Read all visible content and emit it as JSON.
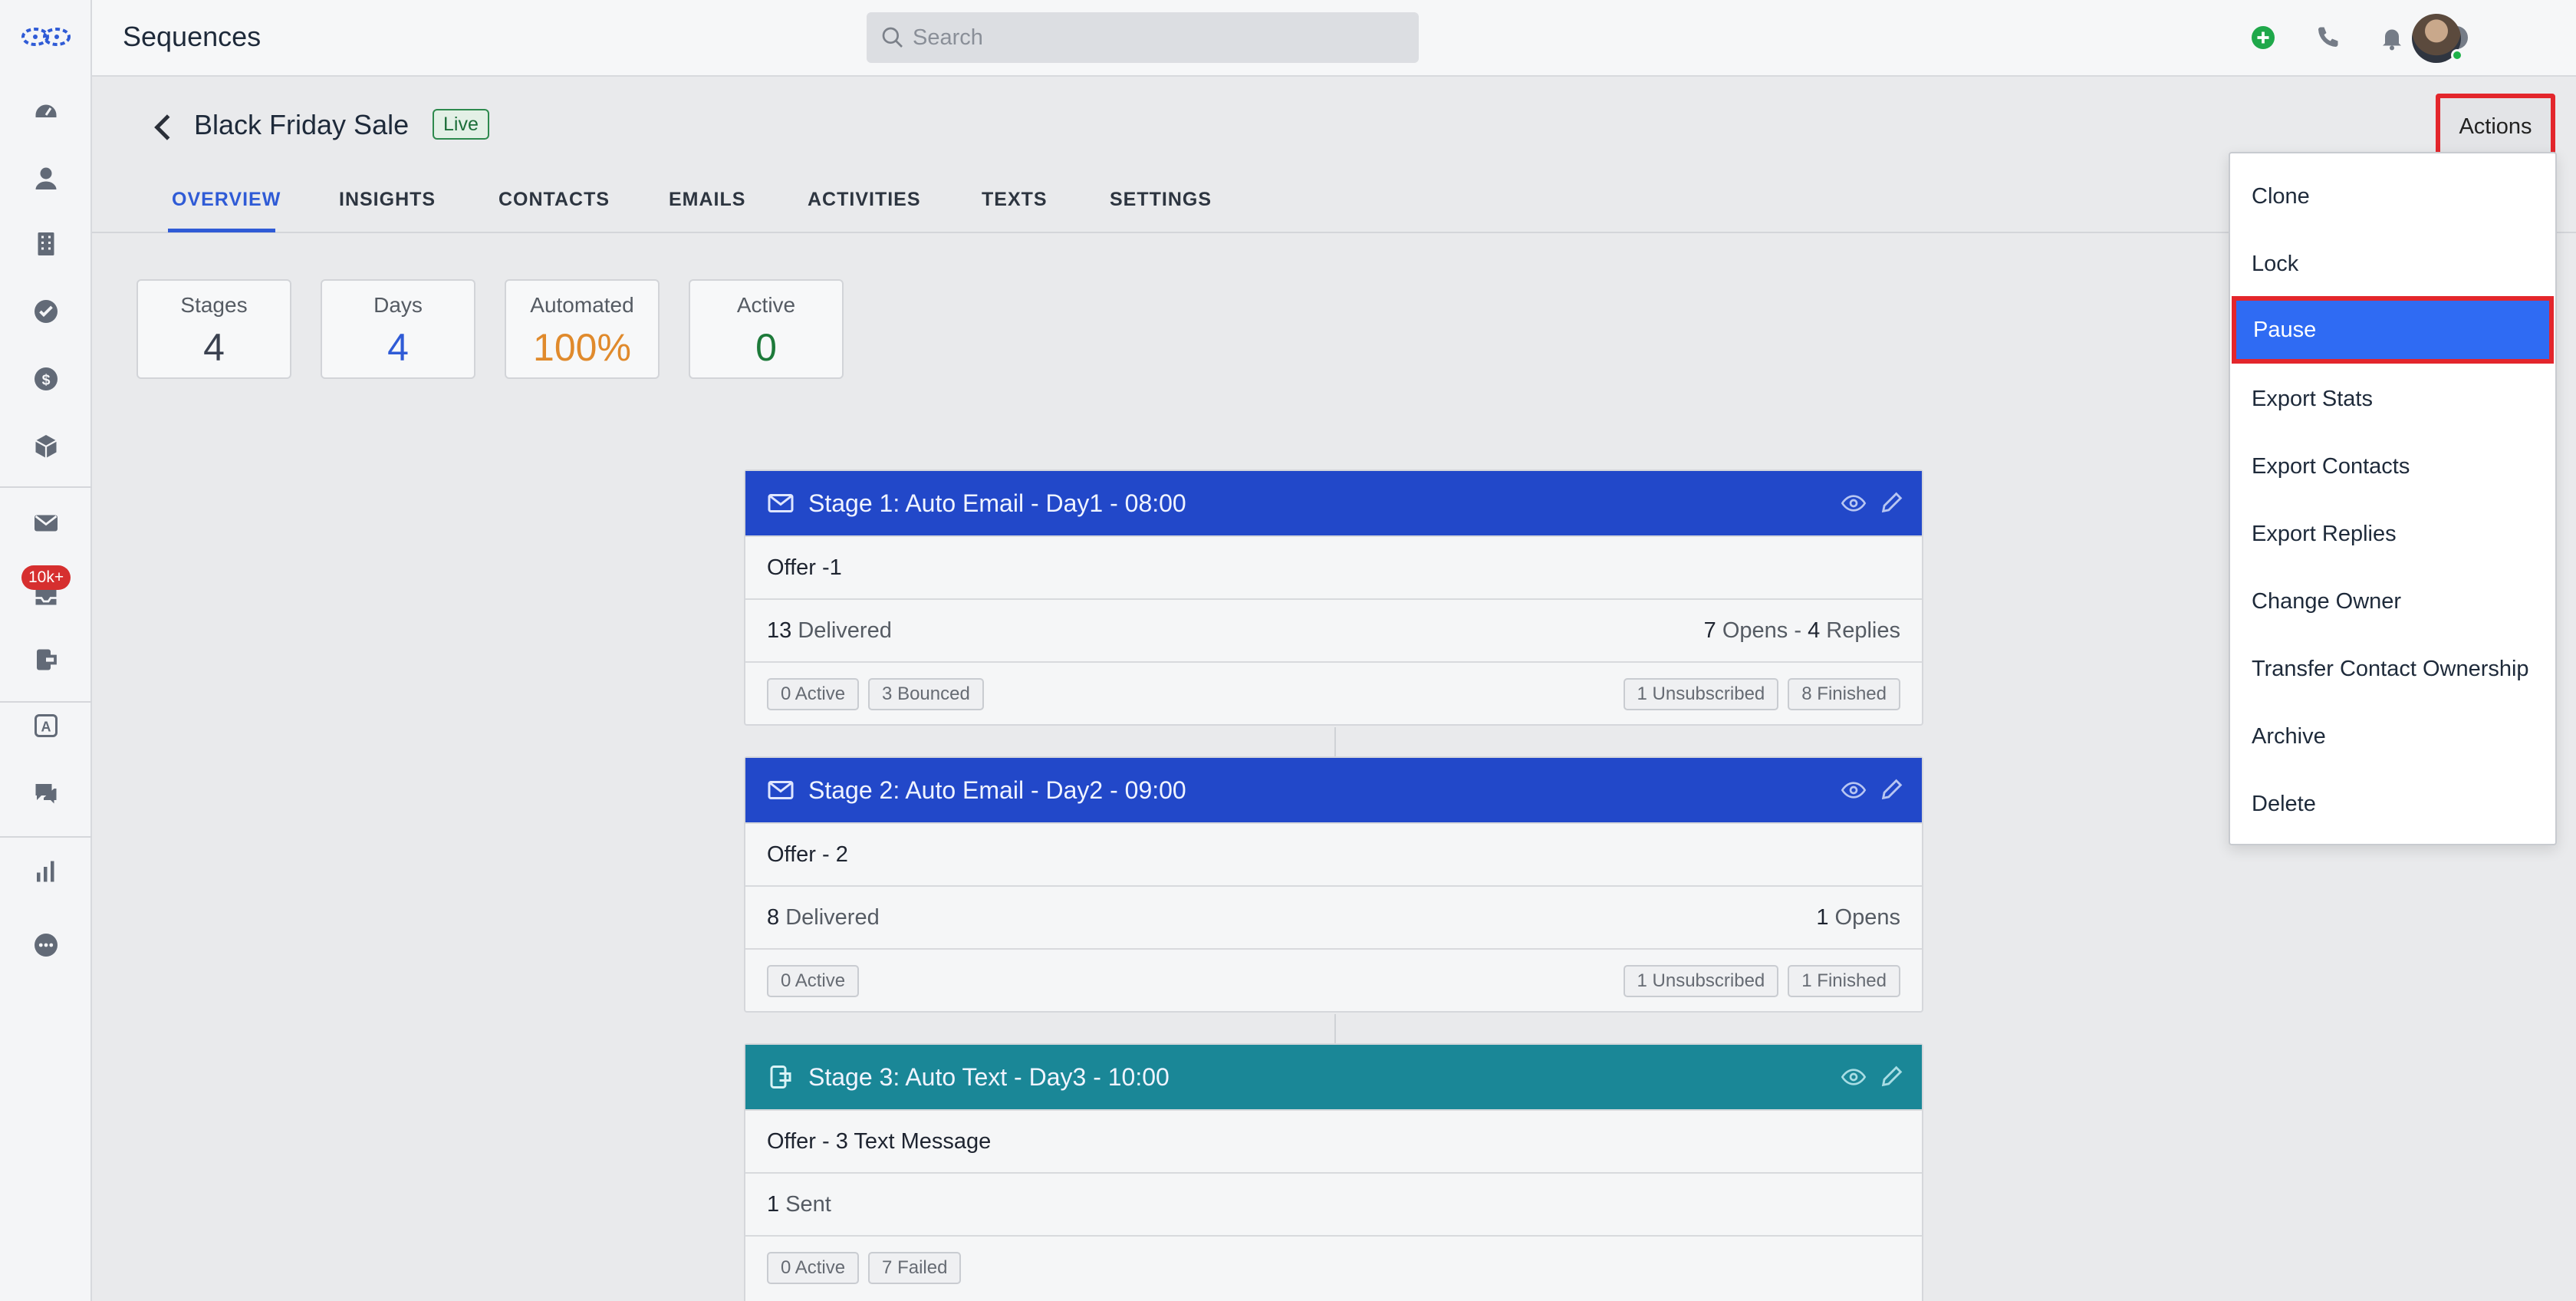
{
  "header": {
    "app_title": "Sequences",
    "search_placeholder": "Search",
    "icons": [
      "add-icon",
      "phone-icon",
      "bell-icon",
      "help-icon"
    ]
  },
  "sidebar": {
    "icons": [
      "dashboard-icon",
      "contacts-icon",
      "companies-icon",
      "tasks-icon",
      "deals-icon",
      "products-icon",
      "mail-icon",
      "inbox-icon",
      "sequences-icon",
      "automation-icon",
      "chat-icon",
      "reports-icon",
      "more-icon"
    ],
    "inbox_badge": "10k+"
  },
  "page": {
    "title": "Black Friday Sale",
    "status": "Live",
    "actions_label": "Actions"
  },
  "tabs": [
    "OVERVIEW",
    "INSIGHTS",
    "CONTACTS",
    "EMAILS",
    "ACTIVITIES",
    "TEXTS",
    "SETTINGS"
  ],
  "active_tab": "OVERVIEW",
  "stats": [
    {
      "label": "Stages",
      "value": "4",
      "color": "#3a4150"
    },
    {
      "label": "Days",
      "value": "4",
      "color": "#2f5bd6"
    },
    {
      "label": "Automated",
      "value": "100%",
      "color": "#e08a2c"
    },
    {
      "label": "Active",
      "value": "0",
      "color": "#1d7a3a"
    }
  ],
  "stages": [
    {
      "title": "Stage 1: Auto Email - Day1 - 08:00",
      "type": "email",
      "color": "#2248c9",
      "name": "Offer -1",
      "left_metric": {
        "num": "13",
        "label": " Delivered"
      },
      "right_metric": {
        "num1": "7",
        "label1": " Opens",
        "sep": " - ",
        "num2": "4",
        "label2": " Replies"
      },
      "chips_left": [
        "0 Active",
        "3 Bounced"
      ],
      "chips_right": [
        "1 Unsubscribed",
        "8 Finished"
      ]
    },
    {
      "title": "Stage 2: Auto Email - Day2 - 09:00",
      "type": "email",
      "color": "#2248c9",
      "name": "Offer - 2",
      "left_metric": {
        "num": "8",
        "label": " Delivered"
      },
      "right_metric": {
        "num1": "1",
        "label1": " Opens"
      },
      "chips_left": [
        "0 Active"
      ],
      "chips_right": [
        "1 Unsubscribed",
        "1 Finished"
      ]
    },
    {
      "title": "Stage 3: Auto Text - Day3 - 10:00",
      "type": "text",
      "color": "#1a8797",
      "name": "Offer - 3 Text Message",
      "left_metric": {
        "num": "1",
        "label": " Sent"
      },
      "chips_left": [
        "0 Active",
        "7 Failed"
      ],
      "chips_right": []
    }
  ],
  "dropdown": {
    "items": [
      "Clone",
      "Lock",
      "Pause",
      "Export Stats",
      "Export Contacts",
      "Export Replies",
      "Change Owner",
      "Transfer Contact Ownership",
      "Archive",
      "Delete"
    ],
    "selected": "Pause"
  }
}
